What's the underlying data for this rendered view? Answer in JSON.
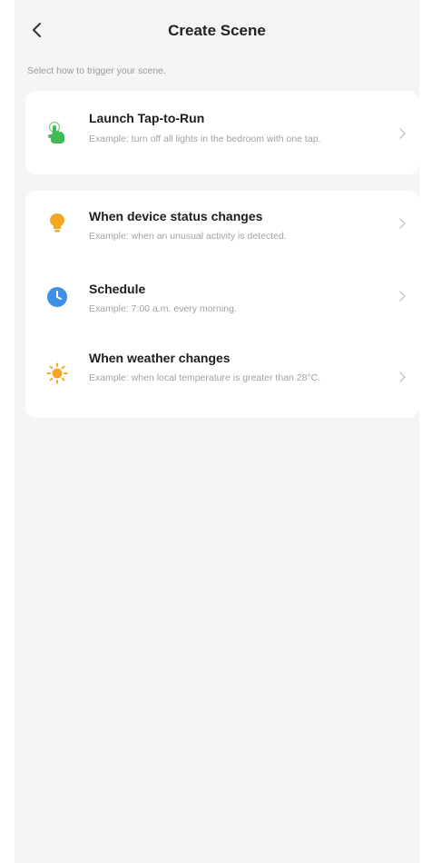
{
  "header": {
    "title": "Create Scene",
    "back_icon": "chevron-left-icon"
  },
  "subtitle": "Select how to trigger your scene.",
  "options": {
    "tap_to_run": {
      "label": "Launch Tap-to-Run",
      "description": "Example: turn off all lights in the bedroom with one tap.",
      "icon": "tap-hand-icon",
      "icon_color": "#3fba54"
    },
    "device_status": {
      "label": "When device status changes",
      "description": "Example: when an unusual activity is detected.",
      "icon": "lightbulb-icon",
      "icon_color": "#f5a623"
    },
    "schedule": {
      "label": "Schedule",
      "description": "Example: 7:00 a.m. every morning.",
      "icon": "clock-icon",
      "icon_color": "#3d8fe8"
    },
    "weather": {
      "label": "When weather changes",
      "description": "Example: when local temperature is greater than 28°C.",
      "icon": "sun-icon",
      "icon_color": "#f5a623"
    }
  }
}
